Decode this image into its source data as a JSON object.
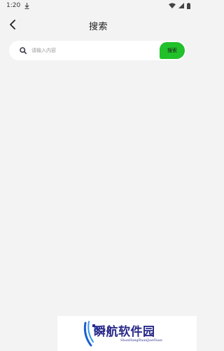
{
  "status_bar": {
    "time": "1:20",
    "icons": [
      "download-icon",
      "wifi-icon",
      "signal-icon",
      "battery-icon"
    ]
  },
  "header": {
    "title": "搜索",
    "back_icon": "chevron-left-icon"
  },
  "search": {
    "placeholder": "请输入内容",
    "value": "",
    "button_label": "搜索",
    "icon": "search-icon"
  },
  "colors": {
    "background": "#f3f3f3",
    "accent": "#22c02a",
    "watermark_text": "#2a2a8a"
  },
  "watermark": {
    "title": "瞬航软件园",
    "subtitle": "ShunHangRuanJianYuan"
  }
}
